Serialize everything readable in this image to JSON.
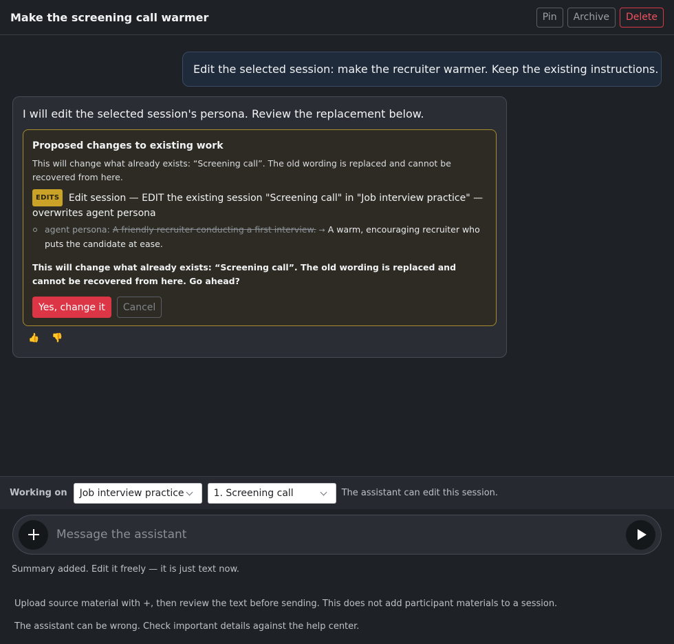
{
  "header": {
    "title": "Make the screening call warmer",
    "pin_label": "Pin",
    "archive_label": "Archive",
    "delete_label": "Delete"
  },
  "user_message": "Edit the selected session: make the recruiter warmer. Keep the existing instructions.",
  "assistant": {
    "intro": "I will edit the selected session's persona. Review the replacement below.",
    "proposal": {
      "title": "Proposed changes to existing work",
      "warning": "This will change what already exists: “Screening call”. The old wording is replaced and cannot be recovered from here.",
      "badge": "EDITS",
      "edit_description": "Edit session — EDIT the existing session \"Screening call\" in \"Job interview practice\" — overwrites agent persona",
      "change": {
        "field": "agent persona:",
        "old_value": "A friendly recruiter conducting a first interview.",
        "arrow": "→",
        "new_value": "A warm, encouraging recruiter who puts the candidate at ease."
      },
      "confirm_question": "This will change what already exists: “Screening call”. The old wording is replaced and cannot be recovered from here. Go ahead?",
      "confirm_label": "Yes, change it",
      "cancel_label": "Cancel"
    },
    "feedback": {
      "thumbs_up": "👍",
      "thumbs_down": "👎"
    }
  },
  "context_bar": {
    "label": "Working on",
    "project_select": "Job interview practice",
    "session_select": "1. Screening call",
    "note": "The assistant can edit this session."
  },
  "composer": {
    "placeholder": "Message the assistant",
    "add_icon": "plus-icon",
    "send_icon": "play-icon"
  },
  "notes": {
    "summary": "Summary added. Edit it freely — it is just text now.",
    "upload": "Upload source material with +, then review the text before sending. This does not add participant materials to a session.",
    "disclaimer": "The assistant can be wrong. Check important details against the help center."
  },
  "colors": {
    "background": "#1e2227",
    "danger": "#dc3545",
    "proposal_border": "#a88c2d",
    "badge": "#c9a227"
  }
}
